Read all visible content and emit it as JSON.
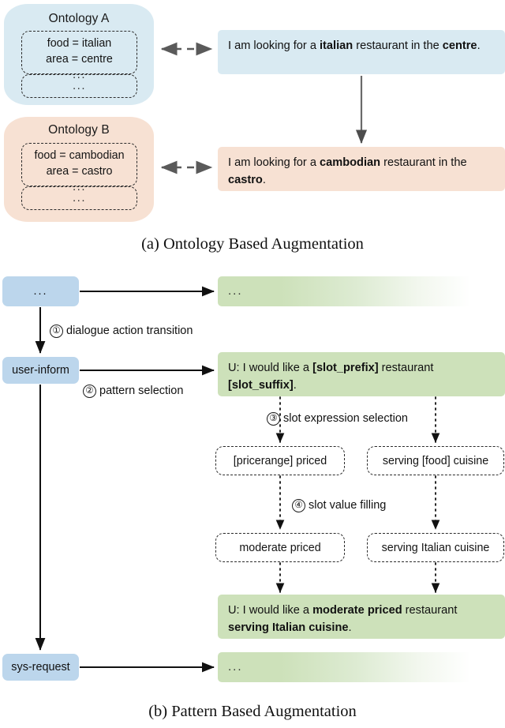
{
  "figure": {
    "panel_a": {
      "caption": "(a) Ontology Based Augmentation",
      "ontologies": [
        {
          "title": "Ontology A",
          "slots": [
            "food = italian",
            "area = centre"
          ],
          "inner_ellipsis": "...",
          "outer_ellipsis": "...",
          "color": "#d9eaf2"
        },
        {
          "title": "Ontology B",
          "slots": [
            "food = cambodian",
            "area = castro"
          ],
          "inner_ellipsis": "...",
          "outer_ellipsis": "...",
          "color": "#f7e1d3"
        }
      ],
      "utterances": [
        {
          "parts": [
            {
              "text": "I am looking for a ",
              "bold": false
            },
            {
              "text": "italian",
              "bold": true
            },
            {
              "text": " restaurant in the ",
              "bold": false
            },
            {
              "text": "centre",
              "bold": true
            },
            {
              "text": ".",
              "bold": false
            }
          ],
          "color": "#d9eaf2"
        },
        {
          "parts": [
            {
              "text": "I am looking for a ",
              "bold": false
            },
            {
              "text": "cambodian",
              "bold": true
            },
            {
              "text": " restaurant in the ",
              "bold": false
            },
            {
              "text": "castro",
              "bold": true
            },
            {
              "text": ".",
              "bold": false
            }
          ],
          "color": "#f7e1d3"
        }
      ]
    },
    "panel_b": {
      "caption": "(b) Pattern Based Augmentation",
      "action_nodes": [
        {
          "label": "..."
        },
        {
          "label": "user-inform"
        },
        {
          "label": "sys-request"
        }
      ],
      "steps": [
        {
          "number": "①",
          "label": "dialogue action transition"
        },
        {
          "number": "②",
          "label": "pattern selection"
        },
        {
          "number": "③",
          "label": "slot expression selection"
        },
        {
          "number": "④",
          "label": "slot value filling"
        }
      ],
      "utterance_top_ellipsis": "...",
      "utterance_bottom_ellipsis": "...",
      "pattern_utterance": {
        "parts": [
          {
            "text": "U: I would like a ",
            "bold": false
          },
          {
            "text": "[slot_prefix]",
            "bold": true
          },
          {
            "text": " restaurant ",
            "bold": false
          },
          {
            "text": "[slot_suffix]",
            "bold": true
          },
          {
            "text": ".",
            "bold": false
          }
        ]
      },
      "filled_utterance": {
        "parts": [
          {
            "text": "U: I would like a ",
            "bold": false
          },
          {
            "text": "moderate priced",
            "bold": true
          },
          {
            "text": " restaurant ",
            "bold": false
          },
          {
            "text": "serving Italian cuisine",
            "bold": true
          },
          {
            "text": ".",
            "bold": false
          }
        ]
      },
      "slot_expressions": [
        "[pricerange] priced",
        "serving [food] cuisine"
      ],
      "slot_values": [
        "moderate priced",
        "serving Italian cuisine"
      ]
    }
  },
  "colors": {
    "blue": "#d9eaf2",
    "peach": "#f7e1d3",
    "green": "#cde1ba",
    "node_blue": "#bcd6ec",
    "arrow_gray": "#5a5a5a",
    "arrow_black": "#1a1a1a"
  }
}
